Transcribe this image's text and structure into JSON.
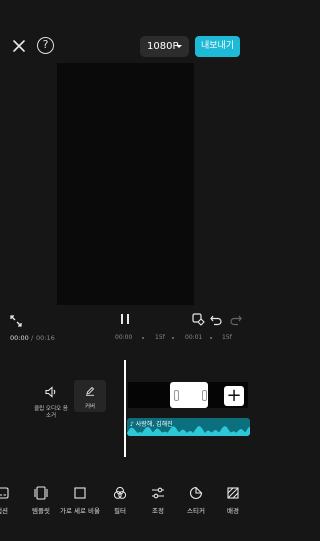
{
  "header": {
    "close_icon": "close-icon",
    "help_label": "?",
    "resolution": "1080P",
    "export_label": "내보내기"
  },
  "colors": {
    "accent": "#1fb9d8",
    "audio_wave": "#2cc8d8"
  },
  "timeline": {
    "current_time": "00:00",
    "separator": "/",
    "total_time": "00:16",
    "ticks": [
      "00:00",
      "15f",
      "00:01",
      "15f"
    ]
  },
  "tracks": {
    "clip_audio_label": "클립 오디오 음소거",
    "cover_label": "커버",
    "audio_clip_title": "사랑해, 김해진"
  },
  "toolbar": [
    {
      "label": "캡션",
      "icon": "caption-icon"
    },
    {
      "label": "템플릿",
      "icon": "template-icon"
    },
    {
      "label": "가로 세로 비율",
      "icon": "aspect-ratio-icon"
    },
    {
      "label": "필터",
      "icon": "filter-icon"
    },
    {
      "label": "조정",
      "icon": "adjust-icon"
    },
    {
      "label": "스티커",
      "icon": "sticker-icon"
    },
    {
      "label": "배경",
      "icon": "background-icon"
    }
  ]
}
